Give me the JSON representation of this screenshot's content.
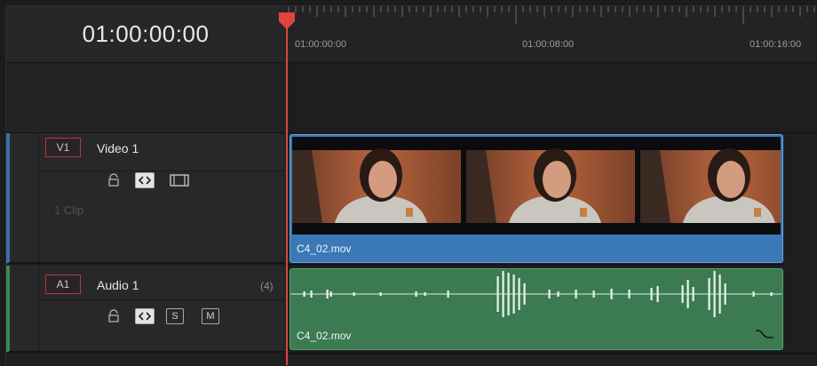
{
  "timecode": {
    "current": "01:00:00:00"
  },
  "ruler": {
    "labels": [
      "01:00:00:00",
      "01:00:08:00",
      "01:00:16:00"
    ]
  },
  "tracks": {
    "video": {
      "id": "V1",
      "name": "Video 1",
      "clip_count": "1 Clip",
      "controls": [
        "lock-icon",
        "auto-select-icon",
        "track-visibility-icon"
      ],
      "clip": {
        "name": "C4_02.mov",
        "color": "#3a79b5"
      }
    },
    "audio": {
      "id": "A1",
      "name": "Audio 1",
      "channel_badge": "(4)",
      "controls": {
        "solo": "S",
        "mute": "M"
      },
      "clip": {
        "name": "C4_02.mov",
        "color": "#3c7a52"
      }
    }
  },
  "colors": {
    "playhead": "#e0453c",
    "video_track_accent": "#3d6fa8",
    "audio_track_accent": "#3a8a55",
    "track_id_border": "#b43a3a"
  }
}
